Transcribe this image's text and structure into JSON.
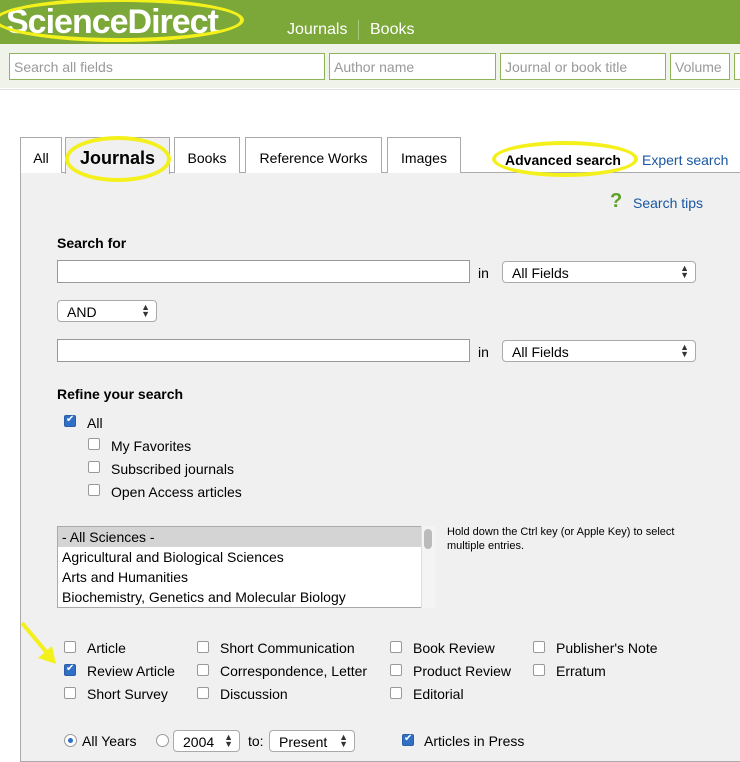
{
  "header": {
    "logo": "ScienceDirect",
    "nav": [
      "Journals",
      "Books"
    ]
  },
  "quick_search": {
    "all_fields_placeholder": "Search all fields",
    "author_placeholder": "Author name",
    "title_placeholder": "Journal or book title",
    "volume_placeholder": "Volume"
  },
  "tabs": [
    "All",
    "Journals",
    "Books",
    "Reference Works",
    "Images"
  ],
  "active_tab": "Journals",
  "links": {
    "advanced": "Advanced search",
    "expert": "Expert search",
    "tips_icon": "?",
    "tips": "Search tips"
  },
  "search": {
    "heading": "Search for",
    "in_label": "in",
    "field1": "All Fields",
    "operator": "AND",
    "field2": "All Fields"
  },
  "refine": {
    "heading": "Refine your search",
    "options": [
      {
        "label": "All",
        "checked": true
      },
      {
        "label": "My Favorites",
        "checked": false
      },
      {
        "label": "Subscribed journals",
        "checked": false
      },
      {
        "label": "Open Access articles",
        "checked": false
      }
    ]
  },
  "subjects": {
    "options": [
      "- All Sciences -",
      "Agricultural and Biological Sciences",
      "Arts and Humanities",
      "Biochemistry, Genetics and Molecular Biology"
    ],
    "selected": "- All Sciences -",
    "hint": "Hold down the Ctrl key (or Apple Key) to select multiple entries."
  },
  "article_types": [
    {
      "label": "Article",
      "checked": false
    },
    {
      "label": "Review Article",
      "checked": true
    },
    {
      "label": "Short Survey",
      "checked": false
    },
    {
      "label": "Short Communication",
      "checked": false
    },
    {
      "label": "Correspondence, Letter",
      "checked": false
    },
    {
      "label": "Discussion",
      "checked": false
    },
    {
      "label": "Book Review",
      "checked": false
    },
    {
      "label": "Product Review",
      "checked": false
    },
    {
      "label": "Editorial",
      "checked": false
    },
    {
      "label": "Publisher's Note",
      "checked": false
    },
    {
      "label": "Erratum",
      "checked": false
    }
  ],
  "years": {
    "all_label": "All Years",
    "from": "2004",
    "to_label": "to:",
    "to": "Present",
    "in_press": "Articles in Press"
  },
  "colors": {
    "brand_green": "#7ba838",
    "link_blue": "#1a57a0",
    "highlight_yellow": "#f3f01c"
  }
}
